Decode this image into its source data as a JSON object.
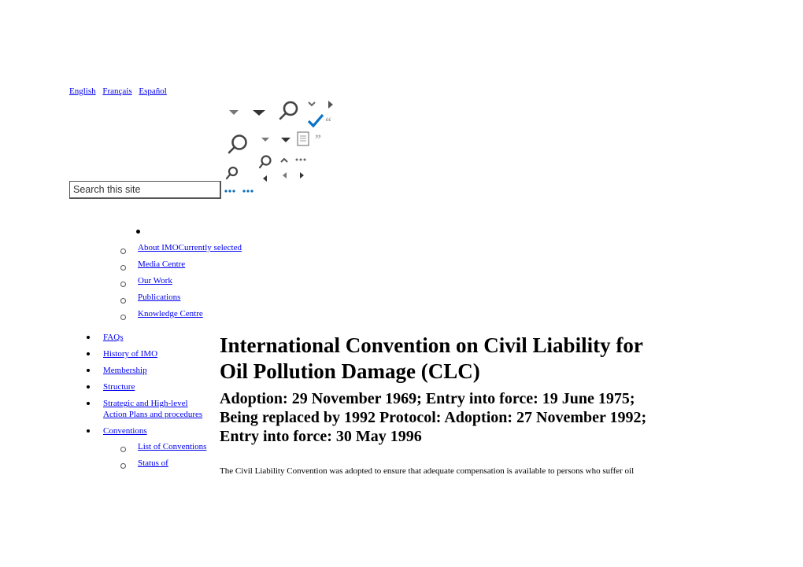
{
  "language_bar": {
    "links": [
      "English",
      "Français",
      "Español"
    ]
  },
  "sprite_icons": [
    "caret-down-icon",
    "caret-down-icon",
    "search-icon",
    "chevron-down-icon",
    "caret-right-icon",
    "checkmark-icon",
    "open-quote-icon",
    "search-icon",
    "caret-down-icon",
    "caret-down-icon",
    "document-icon",
    "close-quote-icon",
    "search-icon",
    "chevron-up-icon",
    "ellipsis-icon",
    "search-icon",
    "caret-left-icon",
    "caret-left-icon",
    "caret-right-icon",
    "ellipsis-icon",
    "ellipsis-icon"
  ],
  "search": {
    "placeholder": "Search this site"
  },
  "top_nav": {
    "items": [
      {
        "label": "About IMOCurrently selected"
      },
      {
        "label": "Media Centre"
      },
      {
        "label": "Our Work"
      },
      {
        "label": "Publications"
      },
      {
        "label": "Knowledge Centre"
      }
    ]
  },
  "side_nav": {
    "items": [
      {
        "label": "FAQs"
      },
      {
        "label": "History of IMO"
      },
      {
        "label": "Membership"
      },
      {
        "label": "Structure"
      },
      {
        "label": "Strategic and High-level "
      },
      {
        "label": "Action Plans and procedures"
      },
      {
        "label": "Conventions"
      }
    ],
    "sub_items": [
      {
        "label": "List of Conventions"
      },
      {
        "label": "Status of "
      }
    ]
  },
  "article": {
    "title_line1": "International Convention on Civil Liability for",
    "title_line2": "Oil Pollution Damage (CLC)",
    "subtitle_line1": "Adoption: 29 November 1969; Entry into force: 19 June 1975;",
    "subtitle_line2": "Being replaced by 1992 Protocol: Adoption: 27 November 1992;",
    "subtitle_line3": "Entry into force: 30 May 1996",
    "body": "The Civil Liability Convention was adopted to ensure that adequate compensation is available to persons who suffer oil"
  },
  "colors": {
    "link": "#0000ee",
    "check_accent": "#0a72c8",
    "icon_gray": "#555555"
  }
}
